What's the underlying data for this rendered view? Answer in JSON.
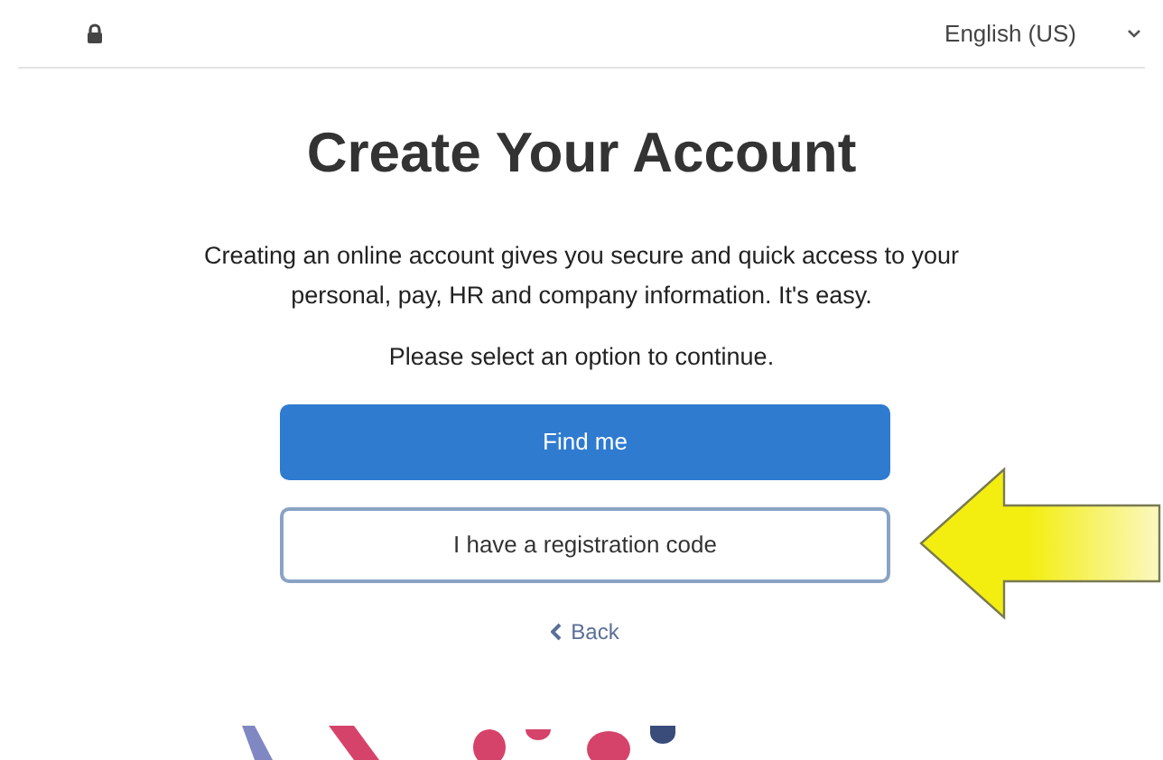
{
  "header": {
    "language": "English (US)"
  },
  "title": "Create Your Account",
  "intro": "Creating an online account gives you secure and quick access to your personal, pay, HR and company information. It's easy.",
  "prompt": "Please select an option to continue.",
  "buttons": [
    {
      "label": "Find me",
      "kind": "primary"
    },
    {
      "label": "I have a registration code",
      "kind": "secondary"
    }
  ],
  "back_link": "Back"
}
